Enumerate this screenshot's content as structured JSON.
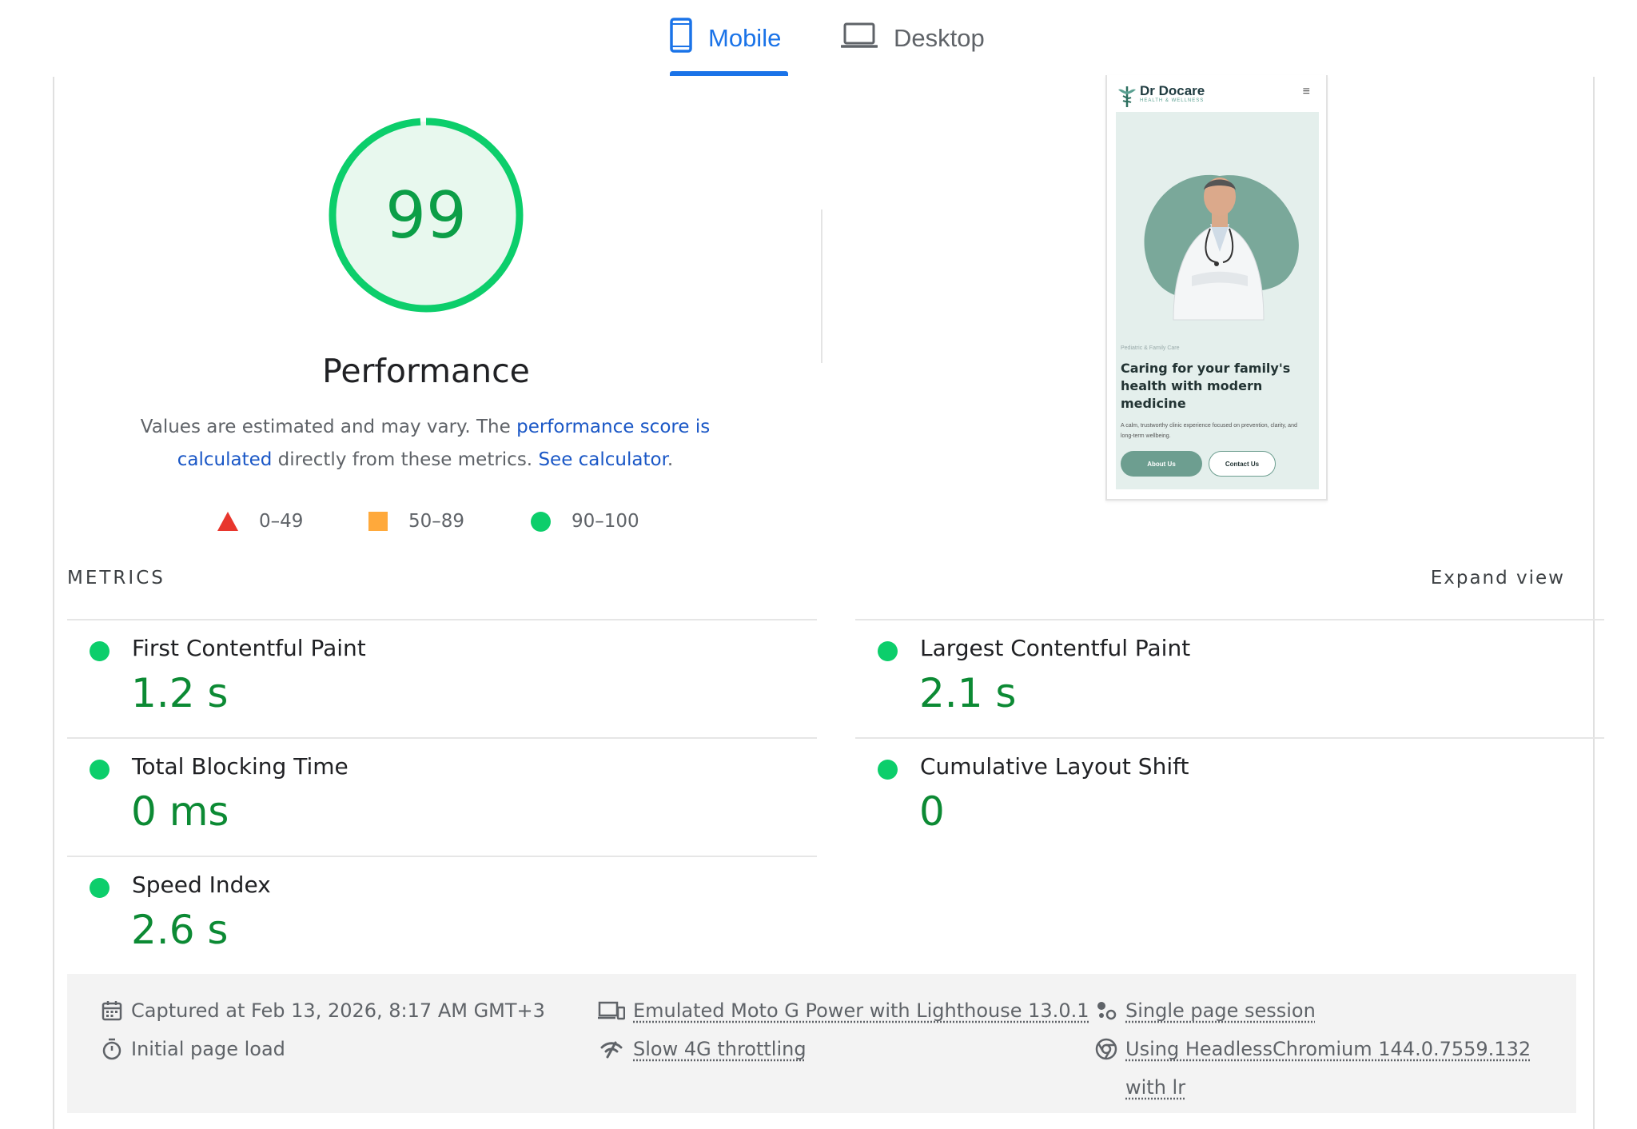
{
  "tabs": [
    {
      "label": "Mobile",
      "icon": "smartphone-icon",
      "active": true
    },
    {
      "label": "Desktop",
      "icon": "laptop-icon",
      "active": false
    }
  ],
  "colors": {
    "accent": "#1a73e8",
    "pass": "#0cce6b",
    "pass_text": "#0c8a34",
    "average": "#ffa93b",
    "fail": "#e8362d"
  },
  "gauge": {
    "score": "99",
    "score_value": 99,
    "title": "Performance"
  },
  "description": {
    "text1": "Values are estimated and may vary. The ",
    "link1": "performance score is calculated",
    "text2": " directly from these metrics. ",
    "link2": "See calculator",
    "text3": "."
  },
  "legend": [
    {
      "label": "0–49",
      "shape": "triangle-icon"
    },
    {
      "label": "50–89",
      "shape": "square-icon"
    },
    {
      "label": "90–100",
      "shape": "circle-icon"
    }
  ],
  "screenshot": {
    "brand": "Dr Docare",
    "brand_sub": "HEALTH & WELLNESS",
    "menu_icon": "≡",
    "eyebrow": "Pediatric & Family Care",
    "headline": "Caring for your family's health with modern medicine",
    "body": "A calm, trustworthy clinic experience focused on prevention, clarity, and long-term wellbeing.",
    "button_primary": "About Us",
    "button_secondary": "Contact Us"
  },
  "metrics": {
    "label": "METRICS",
    "expand": "Expand view",
    "items": [
      {
        "name": "First Contentful Paint",
        "value": "1.2 s"
      },
      {
        "name": "Largest Contentful Paint",
        "value": "2.1 s"
      },
      {
        "name": "Total Blocking Time",
        "value": "0 ms"
      },
      {
        "name": "Cumulative Layout Shift",
        "value": "0"
      },
      {
        "name": "Speed Index",
        "value": "2.6 s"
      }
    ]
  },
  "runtime": {
    "captured": "Captured at Feb 13, 2026, 8:17 AM GMT+3",
    "load": "Initial page load",
    "device": "Emulated Moto G Power with Lighthouse 13.0.1",
    "throttling": "Slow 4G throttling",
    "session": "Single page session",
    "browser": "Using HeadlessChromium 144.0.7559.132 with lr"
  }
}
